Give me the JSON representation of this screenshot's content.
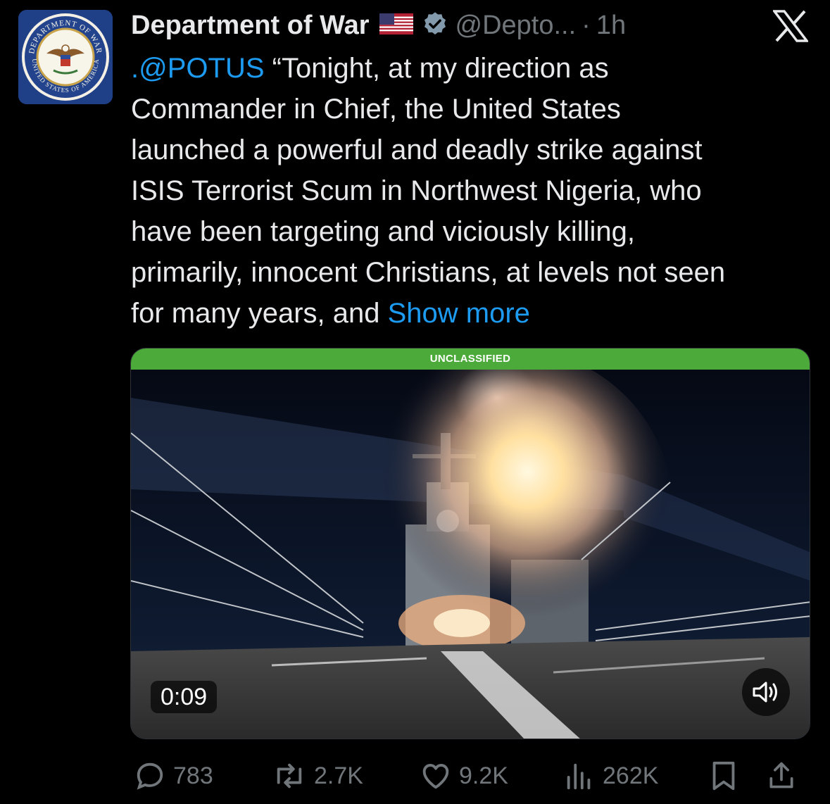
{
  "account": {
    "display_name": "Department of War",
    "flag_icon": "us-flag-icon",
    "verified_icon": "verified-badge-icon",
    "handle": "@Depto...",
    "separator": "·",
    "time": "1h",
    "avatar_icon": "department-seal-icon",
    "avatar_seal_top": "DEPARTMENT OF WAR",
    "avatar_seal_bottom": "UNITED STATES OF AMERICA"
  },
  "app": {
    "logo_icon": "x-logo-icon"
  },
  "tweet": {
    "mention": ".@POTUS",
    "line1_rest": " “Tonight, at my direction as",
    "line2": "Commander in Chief, the United States",
    "line3": "launched a powerful and deadly strike against",
    "line4": "ISIS Terrorist Scum in Northwest Nigeria, who",
    "line5": "have been targeting and viciously killing,",
    "line6": "primarily, innocent Christians, at levels not seen",
    "line7": "for many years, and ",
    "show_more": "Show more"
  },
  "media": {
    "banner": "UNCLASSIFIED",
    "duration": "0:09",
    "mute_icon": "speaker-icon",
    "banner_color": "#4caa3a"
  },
  "actions": {
    "replies": "783",
    "reposts": "2.7K",
    "likes": "9.2K",
    "views": "262K",
    "reply_icon": "reply-icon",
    "repost_icon": "repost-icon",
    "like_icon": "heart-icon",
    "views_icon": "views-chart-icon",
    "bookmark_icon": "bookmark-icon",
    "share_icon": "share-icon"
  },
  "colors": {
    "background": "#000000",
    "text": "#e7e9ea",
    "muted": "#71767b",
    "link": "#1d9bf0"
  }
}
